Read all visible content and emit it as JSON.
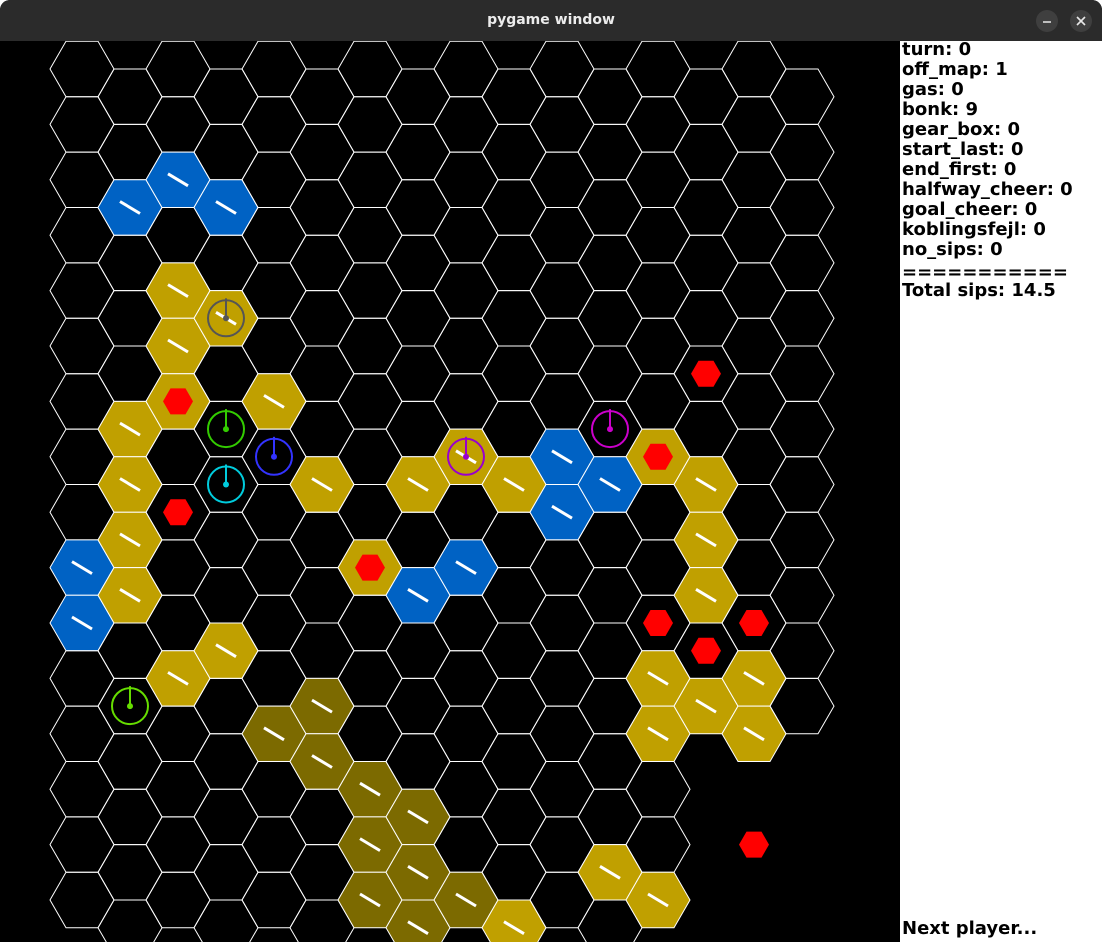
{
  "window": {
    "title": "pygame window"
  },
  "stats": [
    {
      "key": "turn",
      "value": "0"
    },
    {
      "key": "off_map",
      "value": "1"
    },
    {
      "key": "gas",
      "value": "0"
    },
    {
      "key": "bonk",
      "value": "9"
    },
    {
      "key": "gear_box",
      "value": "0"
    },
    {
      "key": "start_last",
      "value": "0"
    },
    {
      "key": "end_first",
      "value": "0"
    },
    {
      "key": "halfway_cheer",
      "value": "0"
    },
    {
      "key": "goal_cheer",
      "value": "0"
    },
    {
      "key": "koblingsfejl",
      "value": "0"
    },
    {
      "key": "no_sips",
      "value": "0"
    }
  ],
  "separator": "===========",
  "total_sips": "Total sips: 14.5",
  "status": "Next player...",
  "colors": {
    "grid_line": "#ffffff",
    "track_gold": "#c0a000",
    "track_blue": "#0062c4",
    "track_dark": "#7c6a00",
    "hazard_red": "#ff0000",
    "board_bg": "#000000",
    "panel_bg": "#ffffff",
    "titlebar_bg": "#2b2b2b"
  },
  "board": {
    "tiles_gold": [
      [
        3,
        3
      ],
      [
        5,
        3
      ],
      [
        4,
        4
      ],
      [
        5,
        5
      ],
      [
        4,
        6
      ],
      [
        3,
        7
      ],
      [
        3,
        8
      ],
      [
        3,
        9
      ],
      [
        3,
        10
      ],
      [
        4,
        11
      ],
      [
        5,
        11
      ],
      [
        7,
        8
      ],
      [
        8,
        9
      ],
      [
        9,
        8
      ],
      [
        10,
        7
      ],
      [
        11,
        8
      ],
      [
        14,
        7
      ],
      [
        15,
        8
      ],
      [
        15,
        9
      ],
      [
        15,
        10
      ],
      [
        14,
        11
      ],
      [
        16,
        11
      ],
      [
        14,
        12
      ],
      [
        16,
        12
      ],
      [
        15,
        12
      ],
      [
        15,
        13
      ],
      [
        15,
        14
      ],
      [
        14,
        15
      ],
      [
        13,
        15
      ],
      [
        11,
        16
      ],
      [
        10,
        17
      ],
      [
        6,
        6
      ],
      [
        4,
        5
      ]
    ],
    "tiles_blue": [
      [
        4,
        2
      ],
      [
        3,
        3
      ],
      [
        5,
        3
      ],
      [
        2,
        9
      ],
      [
        2,
        10
      ],
      [
        12,
        7
      ],
      [
        12,
        8
      ],
      [
        13,
        8
      ],
      [
        10,
        9
      ],
      [
        9,
        10
      ],
      [
        12,
        17
      ]
    ],
    "tiles_dark": [
      [
        6,
        12
      ],
      [
        7,
        12
      ],
      [
        7,
        13
      ],
      [
        8,
        13
      ],
      [
        8,
        14
      ],
      [
        9,
        14
      ],
      [
        9,
        15
      ],
      [
        10,
        15
      ],
      [
        8,
        15
      ],
      [
        9,
        16
      ]
    ],
    "hazards": [
      [
        4,
        6
      ],
      [
        4,
        8
      ],
      [
        8,
        9
      ],
      [
        14,
        7
      ],
      [
        15,
        6
      ],
      [
        14,
        10
      ],
      [
        15,
        11
      ],
      [
        16,
        10
      ],
      [
        16,
        14
      ]
    ],
    "players": [
      {
        "col": 5,
        "row": 5,
        "color": "#555555"
      },
      {
        "col": 5,
        "row": 7,
        "color": "#33cc00"
      },
      {
        "col": 6,
        "row": 7,
        "color": "#3333ff"
      },
      {
        "col": 5,
        "row": 8,
        "color": "#00ccdd"
      },
      {
        "col": 10,
        "row": 7,
        "color": "#9900cc"
      },
      {
        "col": 13,
        "row": 7,
        "color": "#cc00cc"
      },
      {
        "col": 3,
        "row": 12,
        "color": "#66dd00"
      }
    ]
  }
}
